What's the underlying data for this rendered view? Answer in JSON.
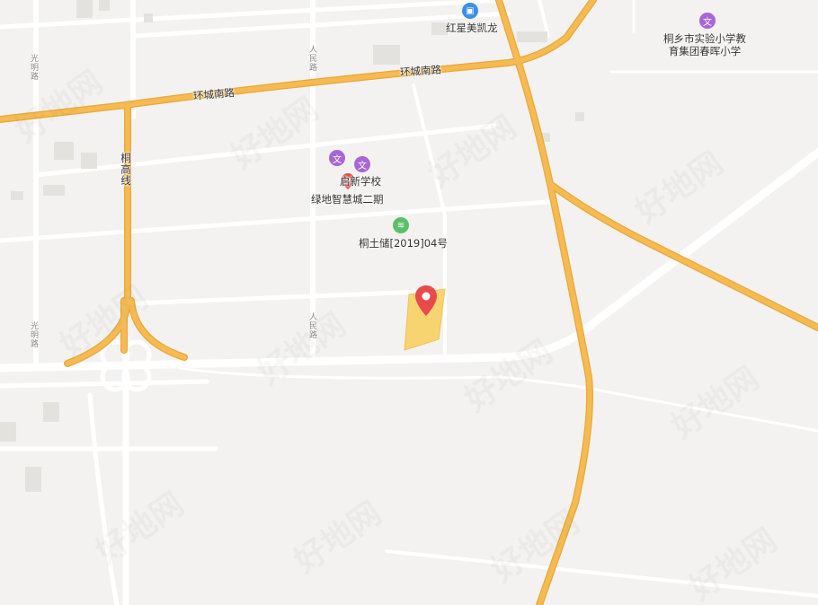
{
  "colors": {
    "background": "#f3f2f0",
    "minor_road": "#ffffff",
    "major_road": "#f5bb52",
    "major_road_edge": "#eaa73a",
    "building": "#e3e2df",
    "plot": "#f7d470",
    "marker": "#e94b4b"
  },
  "roads": {
    "ring_south": "环城南路",
    "ring_south_2": "环城南路",
    "tonggao": "桐高线",
    "guangming_top": "光明路",
    "guangming_bottom": "光明路",
    "renmin_top": "人民路",
    "renmin_bottom": "人民路"
  },
  "pois": [
    {
      "label": "红星美凯龙",
      "icon": "shop-icon"
    },
    {
      "label": "桐乡市实验小学教\n育集团春晖小学",
      "icon": "school-icon"
    },
    {
      "label": "启新学校",
      "icon": "school-icon"
    },
    {
      "label": "绿地智慧城二期",
      "icon": "map-pin-icon"
    },
    {
      "label": "桐土储[2019]04号",
      "icon": "land-icon"
    }
  ],
  "plot_marker": {
    "icon": "map-pin-icon"
  },
  "watermark": "好地网"
}
